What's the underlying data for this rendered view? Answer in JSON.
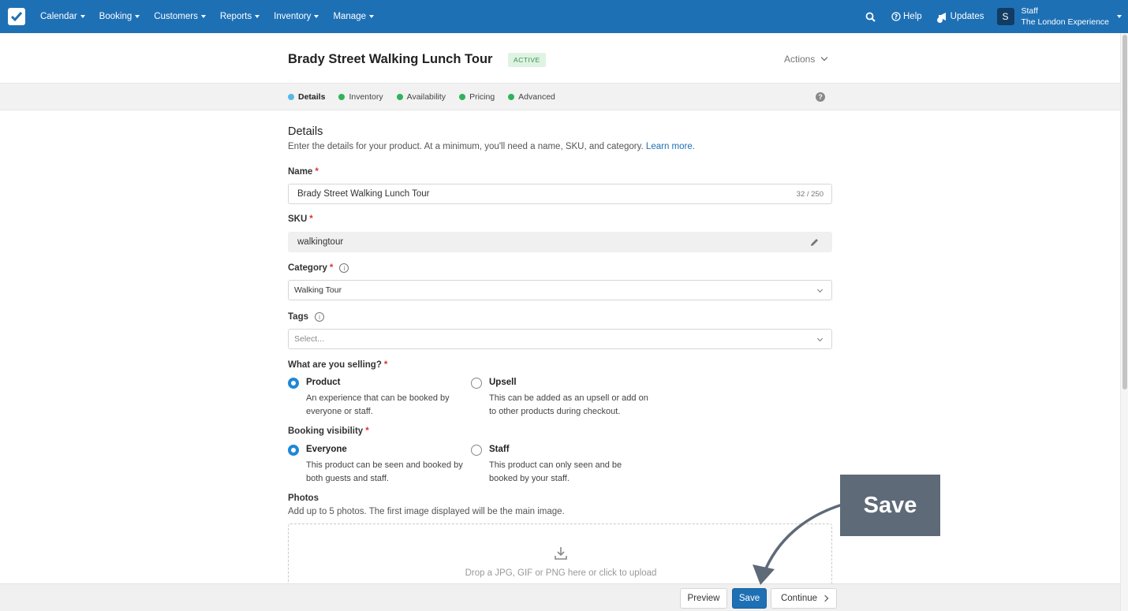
{
  "topnav": {
    "menu": [
      {
        "label": "Calendar"
      },
      {
        "label": "Booking"
      },
      {
        "label": "Customers"
      },
      {
        "label": "Reports"
      },
      {
        "label": "Inventory"
      },
      {
        "label": "Manage"
      }
    ],
    "help_label": "Help",
    "updates_label": "Updates",
    "user": {
      "avatar_letter": "S",
      "role": "Staff",
      "company": "The London Experience"
    }
  },
  "header": {
    "title": "Brady Street Walking Lunch Tour",
    "status": "ACTIVE",
    "actions_label": "Actions"
  },
  "steps": [
    {
      "label": "Details",
      "active": true
    },
    {
      "label": "Inventory"
    },
    {
      "label": "Availability"
    },
    {
      "label": "Pricing"
    },
    {
      "label": "Advanced"
    }
  ],
  "details": {
    "title": "Details",
    "description": "Enter the details for your product. At a minimum, you'll need a name, SKU, and category.",
    "learn_more": "Learn more.",
    "name": {
      "label": "Name",
      "value": "Brady Street Walking Lunch Tour",
      "counter": "32 / 250"
    },
    "sku": {
      "label": "SKU",
      "value": "walkingtour"
    },
    "category": {
      "label": "Category",
      "value": "Walking Tour"
    },
    "tags": {
      "label": "Tags",
      "placeholder": "Select..."
    },
    "selling": {
      "label": "What are you selling?",
      "options": [
        {
          "title": "Product",
          "desc": "An experience that can be booked by everyone or staff.",
          "checked": true
        },
        {
          "title": "Upsell",
          "desc": "This can be added as an upsell or add on to other products during checkout.",
          "checked": false
        }
      ]
    },
    "visibility": {
      "label": "Booking visibility",
      "options": [
        {
          "title": "Everyone",
          "desc": "This product can be seen and booked by both guests and staff.",
          "checked": true
        },
        {
          "title": "Staff",
          "desc": "This product can only seen and be booked by your staff.",
          "checked": false
        }
      ]
    },
    "photos": {
      "label": "Photos",
      "description": "Add up to 5 photos. The first image displayed will be the main image.",
      "dropzone_text": "Drop a JPG, GIF or PNG here or click to upload"
    }
  },
  "footer": {
    "preview_label": "Preview",
    "save_label": "Save",
    "continue_label": "Continue"
  },
  "annotation": {
    "label": "Save"
  },
  "colors": {
    "nav_bg": "#1e70b5",
    "primary": "#1e70b5",
    "active_step": "#55b8e8",
    "done_step": "#2fb35a",
    "callout_bg": "#5e6a78",
    "required": "#dd3333"
  }
}
